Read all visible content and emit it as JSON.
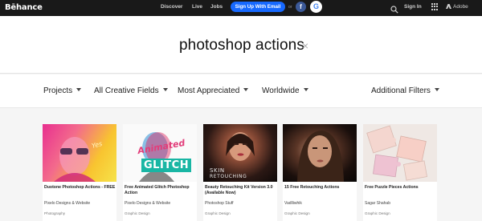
{
  "header": {
    "logo": "Bēhance",
    "nav": [
      "Discover",
      "Live",
      "Jobs"
    ],
    "signup_label": "Sign Up With Email",
    "or_label": "or",
    "facebook_glyph": "f",
    "google_glyph": "G",
    "signin_label": "Sign In",
    "adobe_label": "Adobe"
  },
  "search": {
    "query": "photoshop actions",
    "clear_glyph": "×"
  },
  "filters": {
    "projects": "Projects",
    "creative_fields": "All Creative Fields",
    "sort": "Most Appreciated",
    "location": "Worldwide",
    "additional": "Additional Filters"
  },
  "cards": [
    {
      "title": "Duotone Photoshop Actions - FREE",
      "owner": "Pixelo Designs & Website",
      "field": "Photography"
    },
    {
      "title": "Free Animated Glitch Photoshop Action",
      "owner": "Pixelo Designs & Website",
      "field": "Graphic Design",
      "thumb_text": [
        "Animated",
        "GLITCH"
      ]
    },
    {
      "title": "Beauty Retouching Kit Version 3.0 (Available Now)",
      "owner": "Photoshop Stuff",
      "field": "Graphic Design",
      "thumb_text": [
        "SKIN",
        "RETOUCHING"
      ]
    },
    {
      "title": "15 Free Retouching Actions",
      "owner": "Vadlliwhik",
      "field": "Graphic Design"
    },
    {
      "title": "Free Puzzle Pieces Actions",
      "owner": "Sagar Shahab",
      "field": "Graphic Design"
    }
  ],
  "colors": {
    "topbar": "#191919",
    "accent": "#1769ff",
    "facebook": "#3b5998"
  },
  "icons": [
    "search-icon",
    "apps-grid-icon",
    "adobe-logo-icon",
    "chevron-down-icon",
    "close-icon"
  ]
}
